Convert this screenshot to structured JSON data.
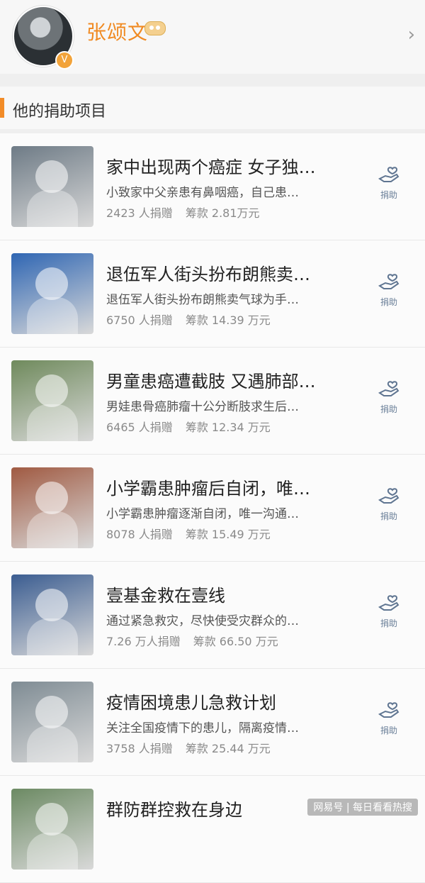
{
  "profile": {
    "name": "张颂文"
  },
  "section": {
    "title": "他的捐助项目"
  },
  "items": [
    {
      "title": "家中出现两个癌症 女子独…",
      "desc": "小致家中父亲患有鼻咽癌，自己患…",
      "donors": "2423 人捐赠",
      "amount": "筹款 2.81万元",
      "action": "捐助",
      "thumb_color": "#6e7b86"
    },
    {
      "title": "退伍军人街头扮布朗熊卖…",
      "desc": "退伍军人街头扮布朗熊卖气球为手…",
      "donors": "6750 人捐赠",
      "amount": "筹款 14.39 万元",
      "action": "捐助",
      "thumb_color": "#2f66b3"
    },
    {
      "title": "男童患癌遭截肢 又遇肺部…",
      "desc": "男娃患骨癌肺瘤十公分断肢求生后…",
      "donors": "6465 人捐赠",
      "amount": "筹款 12.34 万元",
      "action": "捐助",
      "thumb_color": "#6f8a5c"
    },
    {
      "title": "小学霸患肿瘤后自闭，唯…",
      "desc": "小学霸患肿瘤逐渐自闭，唯一沟通…",
      "donors": "8078 人捐赠",
      "amount": "筹款 15.49 万元",
      "action": "捐助",
      "thumb_color": "#a05a42"
    },
    {
      "title": "壹基金救在壹线",
      "desc": "通过紧急救灾，尽快使受灾群众的…",
      "donors": "7.26 万人捐赠",
      "amount": "筹款 66.50 万元",
      "action": "捐助",
      "thumb_color": "#3b5d91"
    },
    {
      "title": "疫情困境患儿急救计划",
      "desc": "关注全国疫情下的患儿，隔离疫情…",
      "donors": "3758 人捐赠",
      "amount": "筹款 25.44 万元",
      "action": "捐助",
      "thumb_color": "#7f8c94"
    },
    {
      "title": "群防群控救在身边",
      "desc": "",
      "donors": "",
      "amount": "",
      "action": "",
      "thumb_color": "#6c8a63"
    }
  ],
  "watermark": "网易号 | 每日看看热搜"
}
